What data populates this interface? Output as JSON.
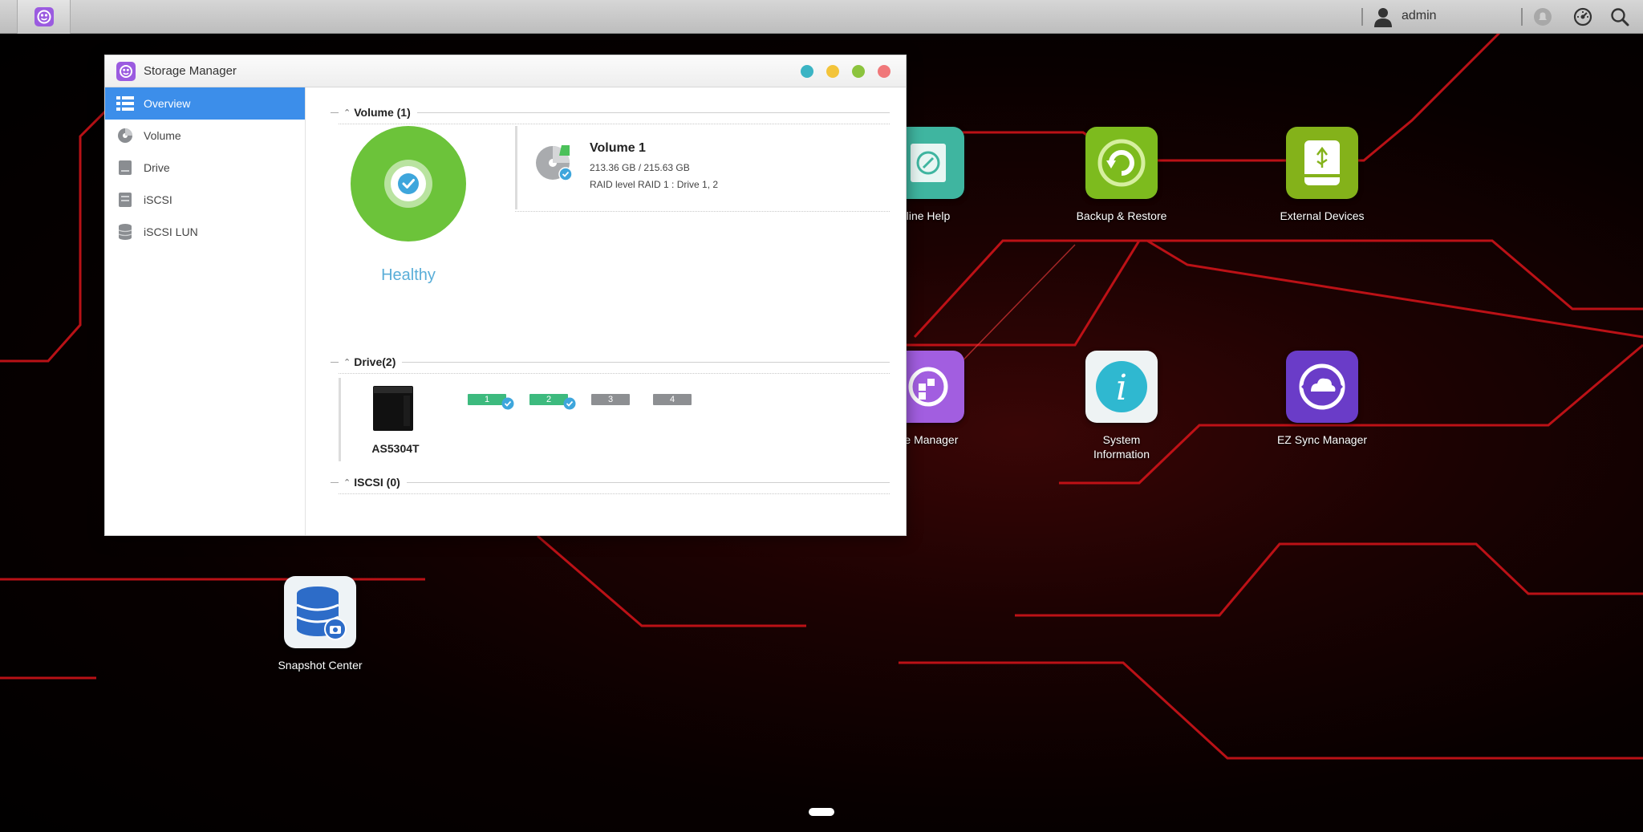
{
  "taskbar": {
    "user": "admin"
  },
  "window": {
    "title": "Storage Manager",
    "sidebar": [
      {
        "label": "Overview"
      },
      {
        "label": "Volume"
      },
      {
        "label": "Drive"
      },
      {
        "label": "iSCSI"
      },
      {
        "label": "iSCSI LUN"
      }
    ],
    "volume_section": {
      "header": "Volume (1)",
      "status": "Healthy",
      "volume": {
        "name": "Volume 1",
        "capacity": "213.36 GB / 215.63 GB",
        "raid": "RAID level RAID 1 : Drive 1, 2"
      }
    },
    "drive_section": {
      "header": "Drive(2)",
      "model": "AS5304T",
      "slots": [
        {
          "label": "1",
          "installed": true
        },
        {
          "label": "2",
          "installed": true
        },
        {
          "label": "3",
          "installed": false
        },
        {
          "label": "4",
          "installed": false
        }
      ]
    },
    "iscsi_section": {
      "header": "ISCSI (0)"
    }
  },
  "desktop": {
    "icons": {
      "online_help": "line Help",
      "backup_restore": "Backup & Restore",
      "external_devices": "External Devices",
      "storage_manager": "ge Manager",
      "system_information": "System Information",
      "ez_sync": "EZ Sync Manager",
      "snapshot_center": "Snapshot Center"
    }
  },
  "colors": {
    "accent": "#3c8eea",
    "healthy_green": "#6cc33a",
    "slot_installed": "#3dba7e",
    "slot_empty": "#8d8f92",
    "close": "#f0787a",
    "minimize": "#f3c43a",
    "maximize": "#8cc43e",
    "pin": "#3bb4c4"
  }
}
